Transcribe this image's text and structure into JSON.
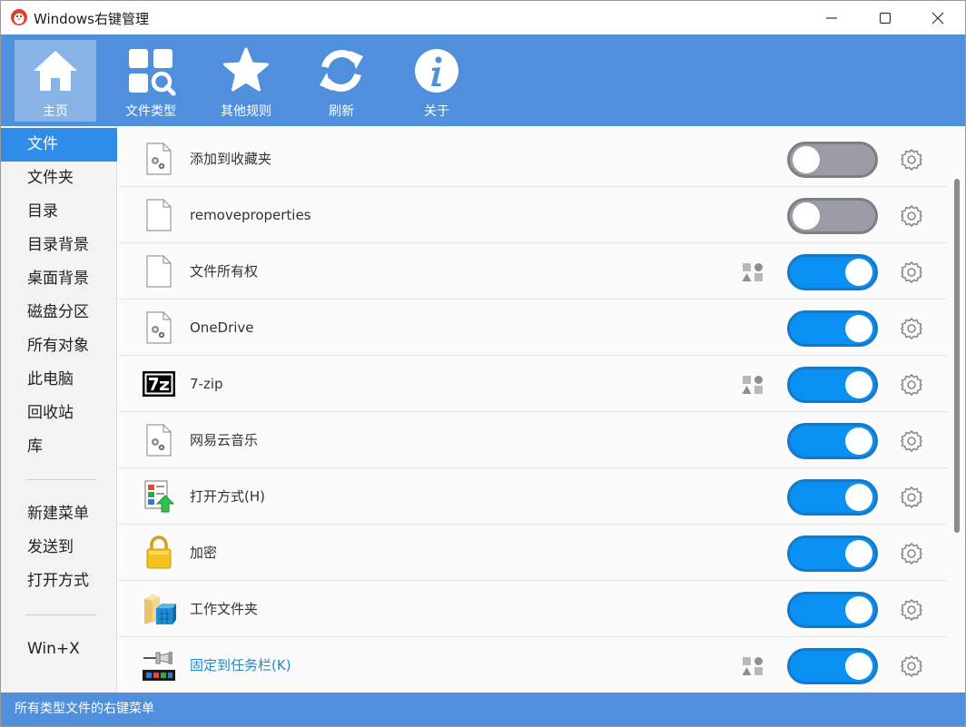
{
  "window": {
    "title": "Windows右键管理"
  },
  "toolbar": {
    "home": "主页",
    "file_types": "文件类型",
    "other_rules": "其他规则",
    "refresh": "刷新",
    "about": "关于"
  },
  "sidebar": {
    "items": [
      "文件",
      "文件夹",
      "目录",
      "目录背景",
      "桌面背景",
      "磁盘分区",
      "所有对象",
      "此电脑",
      "回收站",
      "库"
    ],
    "items2": [
      "新建菜单",
      "发送到",
      "打开方式"
    ],
    "items3": [
      "Win+X"
    ],
    "selected": "文件"
  },
  "rows": [
    {
      "label": "添加到收藏夹",
      "icon": "settings-file-icon",
      "enabled": false,
      "has_shapes": false
    },
    {
      "label": "removeproperties",
      "icon": "blank-file-icon",
      "enabled": false,
      "has_shapes": false
    },
    {
      "label": "文件所有权",
      "icon": "blank-file-icon",
      "enabled": true,
      "has_shapes": true
    },
    {
      "label": "OneDrive",
      "icon": "settings-file-icon",
      "enabled": true,
      "has_shapes": false
    },
    {
      "label": "7-zip",
      "icon": "7zip-icon",
      "enabled": true,
      "has_shapes": true
    },
    {
      "label": "网易云音乐",
      "icon": "settings-file-icon",
      "enabled": true,
      "has_shapes": false
    },
    {
      "label": "打开方式(H)",
      "icon": "open-with-icon",
      "enabled": true,
      "has_shapes": false
    },
    {
      "label": "加密",
      "icon": "lock-icon",
      "enabled": true,
      "has_shapes": false
    },
    {
      "label": "工作文件夹",
      "icon": "work-folder-icon",
      "enabled": true,
      "has_shapes": false
    },
    {
      "label": "固定到任务栏(K)",
      "icon": "pin-taskbar-icon",
      "enabled": true,
      "has_shapes": true
    }
  ],
  "status": {
    "text": "所有类型文件的右键菜单"
  },
  "colors": {
    "accent": "#4f8fdc",
    "toggle_on": "#0a8ff2",
    "toggle_off": "#9a9da3",
    "link": "#1c8ad6"
  }
}
